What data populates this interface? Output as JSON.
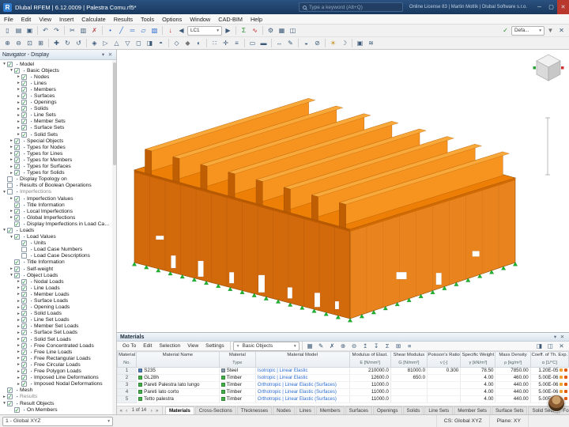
{
  "window": {
    "title": "Dlubal RFEM | 6.12.0009 | Palestra Comu.rf5*",
    "logo_letter": "R",
    "search_placeholder": "Type a keyword (Alt+Q)",
    "license": "Online License 83 | Martin Motlík | Dlubal Software s.r.o.",
    "buttons": [
      [
        "minimize-icon",
        "─"
      ],
      [
        "maximize-icon",
        "▢"
      ],
      [
        "close-icon",
        "✕"
      ]
    ]
  },
  "menu": {
    "items": [
      "File",
      "Edit",
      "View",
      "Insert",
      "Calculate",
      "Results",
      "Tools",
      "Options",
      "Window",
      "CAD-BIM",
      "Help"
    ]
  },
  "toolbar1": {
    "items": [
      [
        "new-model-icon",
        "▯"
      ],
      [
        "open-file-icon",
        "▤"
      ],
      [
        "save-file-icon",
        "▣"
      ],
      "|",
      [
        "undo-icon",
        "↶"
      ],
      [
        "redo-icon",
        "↷"
      ],
      "|",
      [
        "cut-icon",
        "✂"
      ],
      [
        "copy-icon",
        "▥"
      ],
      [
        "delete-icon",
        "✗",
        "#b44040"
      ],
      "|",
      [
        "node-icon",
        "•",
        "#2a6bd0"
      ],
      [
        "line-icon",
        "╱",
        "#2a6bd0"
      ],
      [
        "member-icon",
        "═",
        "#2a6bd0"
      ],
      [
        "surface-icon",
        "▱",
        "#2a6bd0"
      ],
      [
        "solid-icon",
        "▧",
        "#2a6bd0"
      ],
      "|",
      [
        "loads-icon",
        "↓",
        "#c02020"
      ],
      [
        "prev-load-case-icon",
        "◀"
      ],
      {
        "combo": "LC1",
        "name": "load-case-combo",
        "w": 44
      },
      [
        "next-load-case-icon",
        "▶"
      ],
      "|",
      [
        "calculate-icon",
        "Σ",
        "#1f8a2f"
      ],
      [
        "results-icon",
        "∿",
        "#c02020"
      ],
      "|",
      [
        "settings-gear-icon",
        "⚙"
      ],
      [
        "tables-icon",
        "▦"
      ],
      [
        "dock-panel-icon",
        "◫"
      ],
      {
        "space": true
      },
      [
        "visibility-check-icon",
        "✓",
        "#1f8a2f"
      ],
      {
        "combo": "Defa...",
        "name": "visibility-combo",
        "w": 42
      },
      [
        "view-filter-icon",
        "▼",
        "#777"
      ],
      [
        "panel-close-icon",
        "✕"
      ]
    ]
  },
  "toolbar2": {
    "items": [
      [
        "zoom-in-icon",
        "⊕"
      ],
      [
        "zoom-out-icon",
        "⊖"
      ],
      [
        "zoom-fit-icon",
        "⊡"
      ],
      [
        "zoom-window-icon",
        "⊞"
      ],
      "|",
      [
        "pan-icon",
        "✚"
      ],
      [
        "orbit-cw-icon",
        "↻"
      ],
      [
        "orbit-ccw-icon",
        "↺"
      ],
      "|",
      [
        "view-iso-icon",
        "◈"
      ],
      [
        "view-x-icon",
        "▷"
      ],
      [
        "view-y-icon",
        "△"
      ],
      [
        "view-z-icon",
        "▽"
      ],
      [
        "view-front-icon",
        "◻"
      ],
      [
        "view-side-icon",
        "◨"
      ],
      [
        "view-top-icon",
        "◓"
      ],
      "|",
      [
        "wireframe-icon",
        "◇"
      ],
      [
        "solid-render-icon",
        "◆",
        "#777"
      ],
      [
        "transparent-icon",
        "◐"
      ],
      "|",
      [
        "grid-icon",
        "∷"
      ],
      [
        "snap-icon",
        "✛"
      ],
      [
        "guidelines-icon",
        "≡"
      ],
      "|",
      [
        "select-window-icon",
        "▭"
      ],
      [
        "select-all-icon",
        "▬"
      ],
      "|",
      [
        "dimension-icon",
        "↔"
      ],
      [
        "annotation-icon",
        "✎"
      ],
      "|",
      [
        "clipping-plane-icon",
        "◒"
      ],
      [
        "section-icon",
        "⊘"
      ],
      "|",
      [
        "sun-icon",
        "☀",
        "#c08a10"
      ],
      [
        "shadow-icon",
        "☽"
      ],
      "|",
      [
        "screenshot-icon",
        "▣"
      ],
      [
        "render-icon",
        "≋"
      ]
    ]
  },
  "navigator": {
    "title": "Navigator - Display",
    "header_icons": [
      [
        "pin-icon",
        "▾"
      ],
      [
        "close-icon",
        "✕"
      ]
    ],
    "tree": [
      [
        "Model",
        0,
        1,
        1
      ],
      [
        "Basic Objects",
        1,
        1,
        1
      ],
      [
        "Nodes",
        2,
        2,
        1
      ],
      [
        "Lines",
        2,
        2,
        1
      ],
      [
        "Members",
        2,
        2,
        1
      ],
      [
        "Surfaces",
        2,
        2,
        1
      ],
      [
        "Openings",
        2,
        2,
        1
      ],
      [
        "Solids",
        2,
        2,
        1
      ],
      [
        "Line Sets",
        2,
        2,
        1
      ],
      [
        "Member Sets",
        2,
        2,
        1
      ],
      [
        "Surface Sets",
        2,
        2,
        1
      ],
      [
        "Solid Sets",
        2,
        2,
        1
      ],
      [
        "Special Objects",
        1,
        2,
        1
      ],
      [
        "Types for Nodes",
        1,
        2,
        1
      ],
      [
        "Types for Lines",
        1,
        2,
        1
      ],
      [
        "Types for Members",
        1,
        2,
        1
      ],
      [
        "Types for Surfaces",
        1,
        2,
        1
      ],
      [
        "Types for Solids",
        1,
        2,
        1
      ],
      [
        "Display Topology on",
        0,
        0,
        0
      ],
      [
        "Results of Boolean Operations",
        0,
        0,
        0
      ],
      [
        "Imperfections",
        0,
        1,
        0,
        1
      ],
      [
        "Imperfection Values",
        1,
        2,
        1
      ],
      [
        "Title Information",
        1,
        0,
        1
      ],
      [
        "Local Imperfections",
        1,
        2,
        1
      ],
      [
        "Global Imperfections",
        1,
        2,
        1
      ],
      [
        "Display Imperfections in Load Cases & Combi...",
        1,
        0,
        1
      ],
      [
        "Loads",
        0,
        1,
        1
      ],
      [
        "Load Values",
        1,
        1,
        1
      ],
      [
        "Units",
        2,
        0,
        1
      ],
      [
        "Load Case Numbers",
        2,
        0,
        0
      ],
      [
        "Load Case Descriptions",
        2,
        0,
        0
      ],
      [
        "Title Information",
        1,
        0,
        1
      ],
      [
        "Self-weight",
        1,
        2,
        1
      ],
      [
        "Object Loads",
        1,
        1,
        1
      ],
      [
        "Nodal Loads",
        2,
        2,
        1
      ],
      [
        "Line Loads",
        2,
        2,
        1
      ],
      [
        "Member Loads",
        2,
        2,
        1
      ],
      [
        "Surface Loads",
        2,
        2,
        1
      ],
      [
        "Opening Loads",
        2,
        2,
        1
      ],
      [
        "Solid Loads",
        2,
        2,
        1
      ],
      [
        "Line Set Loads",
        2,
        2,
        1
      ],
      [
        "Member Set Loads",
        2,
        2,
        1
      ],
      [
        "Surface Set Loads",
        2,
        2,
        1
      ],
      [
        "Solid Set Loads",
        2,
        2,
        1
      ],
      [
        "Free Concentrated Loads",
        2,
        2,
        1
      ],
      [
        "Free Line Loads",
        2,
        2,
        1
      ],
      [
        "Free Rectangular Loads",
        2,
        2,
        1
      ],
      [
        "Free Circular Loads",
        2,
        2,
        1
      ],
      [
        "Free Polygon Loads",
        2,
        2,
        1
      ],
      [
        "Imposed Line Deformations",
        2,
        2,
        1
      ],
      [
        "Imposed Nodal Deformations",
        2,
        2,
        1
      ],
      [
        "Mesh",
        0,
        0,
        1
      ],
      [
        "Results",
        0,
        2,
        1,
        1
      ],
      [
        "Result Objects",
        0,
        1,
        1
      ],
      [
        "On Members",
        1,
        0,
        1
      ]
    ]
  },
  "building": {
    "roof_color": "#ee7f06",
    "fin_face_color": "#f79420",
    "fin_top_color": "#f9a83a",
    "fin_cap_color": "#c05e04",
    "wall_long_color": "#d2690a",
    "wall_short_color": "#e8831d",
    "fascia_color": "#b95a03",
    "fascia2_color": "#cf6a05",
    "outline_color": "#8f4b05",
    "support_color": "#1fb32e",
    "opening_color": "#ffffff",
    "fins": 8,
    "supports_long": 19,
    "supports_short": 15,
    "openings_long": [
      [
        0.1,
        36,
        10,
        5
      ],
      [
        0.17,
        5,
        6,
        16
      ],
      [
        0.295,
        3,
        7,
        20
      ],
      [
        0.44,
        5,
        6,
        14
      ],
      [
        0.575,
        3,
        8,
        22
      ],
      [
        0.71,
        5,
        6,
        14
      ],
      [
        0.835,
        3,
        7,
        18
      ],
      [
        0.93,
        7,
        5,
        10
      ]
    ],
    "openings_short": [
      [
        0.28,
        30,
        13,
        9
      ],
      [
        0.52,
        6,
        7,
        15
      ],
      [
        0.74,
        26,
        9,
        7
      ]
    ]
  },
  "materials": {
    "title": "Materials",
    "header_icons": [
      [
        "dock-icon",
        "▾"
      ],
      [
        "close-icon",
        "✕"
      ]
    ],
    "menus": [
      "Go To",
      "Edit",
      "Selection",
      "View",
      "Settings"
    ],
    "filter": "Basic Objects",
    "menu_icons": [
      [
        "table-grid-icon",
        "▦"
      ],
      [
        "edit-cell-icon",
        "✎"
      ],
      [
        "delete-row-icon",
        "✗"
      ],
      [
        "add-row-icon",
        "⊕"
      ],
      [
        "remove-row-icon",
        "⊖"
      ],
      [
        "move-up-icon",
        "↥"
      ],
      [
        "move-down-icon",
        "↧"
      ],
      [
        "sum-icon",
        "Σ"
      ],
      [
        "expand-icon",
        "⊞"
      ],
      [
        "list-icon",
        "≡"
      ]
    ],
    "right_icons": [
      [
        "split-view-icon",
        "◨"
      ],
      [
        "panels-icon",
        "◫"
      ],
      [
        "close-table-icon",
        "✕"
      ]
    ],
    "columns": [
      {
        "main": "Material",
        "sub": "No."
      },
      {
        "main": "Material Name",
        "sub": " "
      },
      {
        "main": "Material",
        "sub": "Type"
      },
      {
        "main": "Material Model",
        "sub": " "
      },
      {
        "main": "Modulus of Elast.",
        "sub": "E [N/mm²]"
      },
      {
        "main": "Shear Modulus",
        "sub": "G [N/mm²]"
      },
      {
        "main": "Poisson's Ratio",
        "sub": "ν [-]"
      },
      {
        "main": "Specific Weight",
        "sub": "γ [kN/m³]"
      },
      {
        "main": "Mass Density",
        "sub": "ρ [kg/m³]"
      },
      {
        "main": "Coeff. of Th. Exp.",
        "sub": "α [1/°C]"
      }
    ],
    "rows": [
      {
        "no": "1",
        "color": "#4f81bd",
        "name": "S235",
        "type": "Steel",
        "type_color": "#8b9cae",
        "model": "Isotropic | Linear Elastic",
        "e": "210000.0",
        "g": "81000.0",
        "nu": "0.300",
        "gamma": "78.50",
        "rho": "7850.00",
        "alpha": "1.20E-05"
      },
      {
        "no": "2",
        "color": "#43b049",
        "name": "GL28h",
        "type": "Timber",
        "type_color": "#43b049",
        "model": "Isotropic | Linear Elastic",
        "e": "12600.0",
        "g": "650.0",
        "nu": "",
        "gamma": "4.00",
        "rho": "460.00",
        "alpha": "5.00E-06"
      },
      {
        "no": "3",
        "color": "#43b049",
        "name": "Pareti Palestra lato lungo",
        "type": "Timber",
        "type_color": "#43b049",
        "model": "Orthotropic | Linear Elastic (Surfaces)",
        "e": "11000.0",
        "g": "",
        "nu": "",
        "gamma": "4.00",
        "rho": "440.00",
        "alpha": "5.00E-06"
      },
      {
        "no": "4",
        "color": "#43b049",
        "name": "Pareti lato corto",
        "type": "Timber",
        "type_color": "#43b049",
        "model": "Orthotropic | Linear Elastic (Surfaces)",
        "e": "11000.0",
        "g": "",
        "nu": "",
        "gamma": "4.00",
        "rho": "440.00",
        "alpha": "5.00E-06"
      },
      {
        "no": "5",
        "color": "#43b049",
        "name": "Tetto palestra",
        "type": "Timber",
        "type_color": "#43b049",
        "model": "Orthotropic | Linear Elastic (Surfaces)",
        "e": "11000.0",
        "g": "",
        "nu": "",
        "gamma": "4.00",
        "rho": "440.00",
        "alpha": "5.00E-06"
      }
    ],
    "pager": "1 of 14",
    "pager_icons": [
      [
        "first-page-icon",
        "«"
      ],
      [
        "prev-page-icon",
        "‹"
      ]
    ],
    "pager_icons_after": [
      [
        "next-page-icon",
        "›"
      ],
      [
        "last-page-icon",
        "»"
      ]
    ],
    "tabs": [
      "Materials",
      "Cross-Sections",
      "Thicknesses",
      "Nodes",
      "Lines",
      "Members",
      "Surfaces",
      "Openings",
      "Solids",
      "Line Sets",
      "Member Sets",
      "Surface Sets",
      "Solid Sets",
      "Formulas"
    ],
    "active_tab": "Materials",
    "alpha_icons": [
      "#f0a030",
      "#e05a10"
    ]
  },
  "statusbar": {
    "view_combo": "1 - Global XYZ",
    "cs": "CS: Global XYZ",
    "plane": "Plane: XY"
  }
}
